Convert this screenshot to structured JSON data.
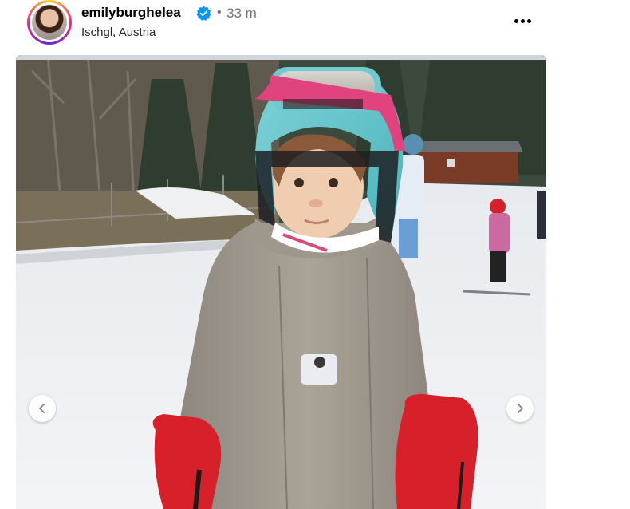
{
  "post": {
    "username": "emilyburghelea",
    "verified": true,
    "separator": "•",
    "time_ago": "33 m",
    "location": "Ischgl, Austria"
  },
  "icons": {
    "verified": "verified-badge-icon",
    "more": "more-options-icon",
    "prev": "chevron-left-icon",
    "next": "chevron-right-icon"
  },
  "colors": {
    "verified_blue": "#0095f6",
    "secondary_text": "#737373",
    "jacket": "#a39c90",
    "mittens": "#d8202a",
    "helmet": "#6fc9cf",
    "goggle_strap": "#e0437e"
  }
}
